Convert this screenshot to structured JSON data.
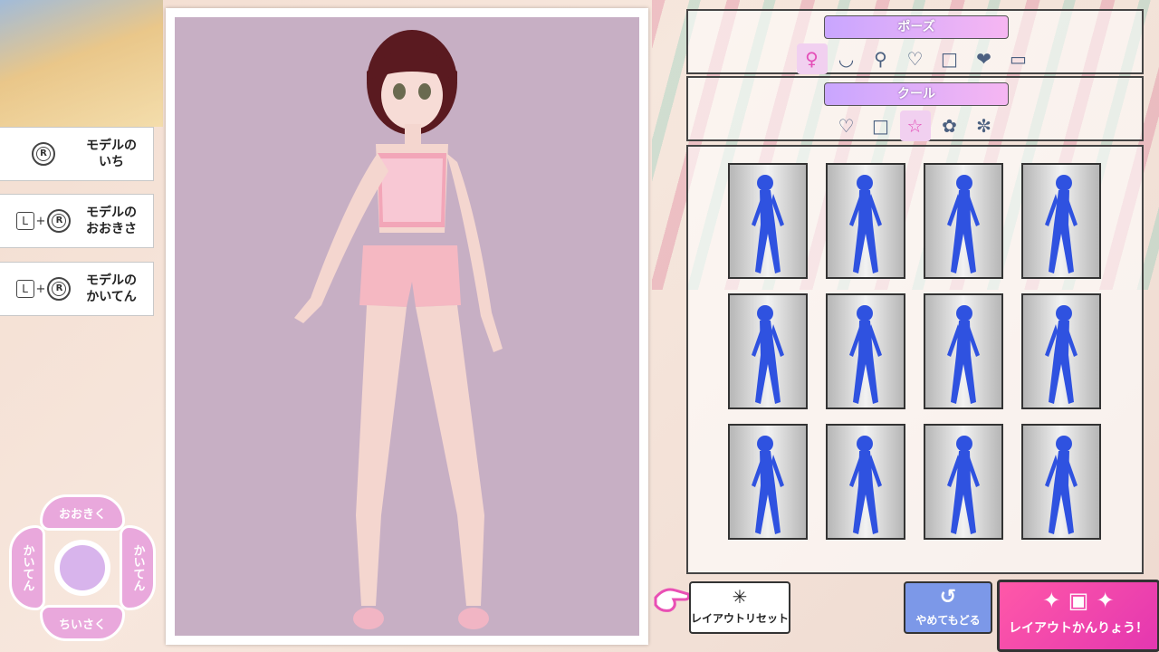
{
  "hints": [
    {
      "line1": "モデルの",
      "line2": "いち",
      "keys": [
        "R"
      ]
    },
    {
      "line1": "モデルの",
      "line2": "おおきさ",
      "keys": [
        "L",
        "+",
        "R"
      ]
    },
    {
      "line1": "モデルの",
      "line2": "かいてん",
      "keys": [
        "L",
        "+",
        "R"
      ]
    }
  ],
  "dpad": {
    "top": "おおきく",
    "bottom": "ちいさく",
    "left": "かいてん",
    "right": "かいてん"
  },
  "pose_panel": {
    "title": "ポーズ",
    "icons": [
      "body-icon",
      "smile-icon",
      "person-icon",
      "heart-frame-icon",
      "square-icon",
      "speech-heart-icon",
      "cards-icon"
    ]
  },
  "style_panel": {
    "title": "クール",
    "icons": [
      "heart-icon",
      "square-icon",
      "star-icon",
      "flower-icon",
      "gear-flower-icon"
    ]
  },
  "poses_count": 12,
  "buttons": {
    "reset": "レイアウトリセット",
    "undo": "やめてもどる",
    "quick": "レイアウトかんりょう！"
  },
  "colors": {
    "accent": "#e9a8dc",
    "pose_silhouette": "#2f52e0",
    "preview_bg": "#c7afc4",
    "quick_button": "#ff58a8"
  }
}
